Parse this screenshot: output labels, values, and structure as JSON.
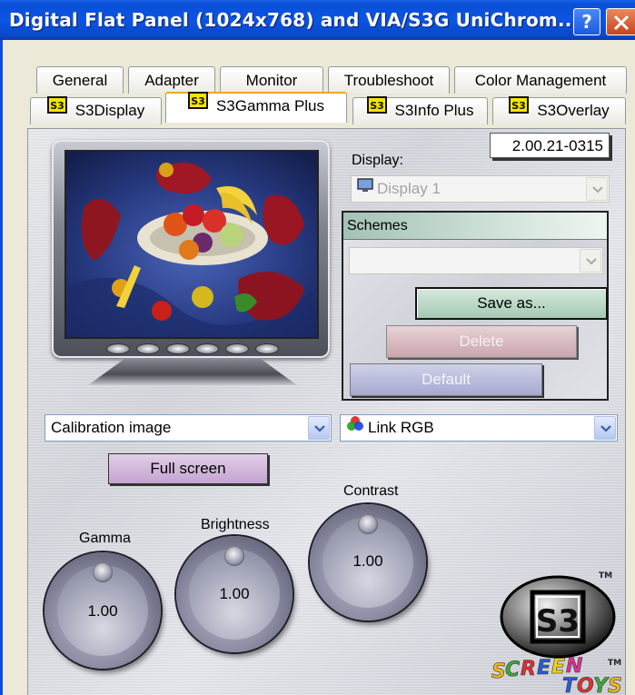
{
  "window": {
    "title": "Digital Flat Panel (1024x768) and VIA/S3G UniChrom...",
    "help_label": "?"
  },
  "tabs_row1": [
    "General",
    "Adapter",
    "Monitor",
    "Troubleshoot",
    "Color Management"
  ],
  "tabs_row2": [
    "S3Display",
    "S3Gamma Plus",
    "S3Info Plus",
    "S3Overlay"
  ],
  "active_tab": "S3Gamma Plus",
  "version": "2.00.21-0315",
  "display": {
    "label": "Display:",
    "value": "Display 1"
  },
  "schemes": {
    "header": "Schemes",
    "value": "",
    "save_as": "Save as...",
    "delete": "Delete",
    "default": "Default"
  },
  "image_select": {
    "value": "Calibration image"
  },
  "channel_select": {
    "value": "Link RGB"
  },
  "full_screen": "Full screen",
  "knobs": {
    "gamma": {
      "label": "Gamma",
      "value": "1.00"
    },
    "brightness": {
      "label": "Brightness",
      "value": "1.00"
    },
    "contrast": {
      "label": "Contrast",
      "value": "1.00"
    }
  },
  "icons": {
    "help": "help-icon",
    "close": "close-icon",
    "s3_tab": "s3-tab-icon",
    "display": "monitor-icon",
    "rgb": "rgb-circles-icon",
    "dropdown": "chevron-down-icon",
    "logo": "s3-screen-toys-logo"
  },
  "logo_marks": {
    "s3": "S3",
    "tm": "TM",
    "brand": "SCREEN TOYS"
  },
  "colors": {
    "title_bar": "#0a4fd6",
    "close_button": "#c8431a",
    "save_button": "#a5c9b3",
    "delete_button": "#c9a6ad",
    "default_button": "#a7a9d0",
    "full_screen_button": "#c4a3d0",
    "active_tab_accent": "#f0a628"
  }
}
